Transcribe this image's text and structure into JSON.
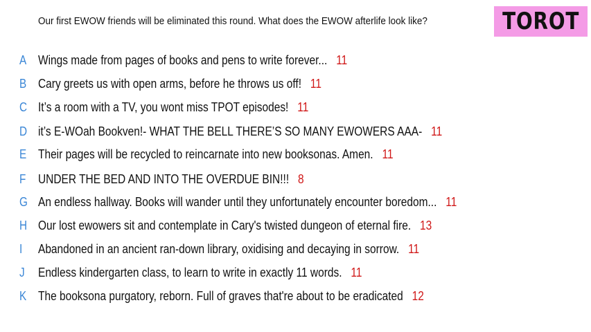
{
  "prompt": "Our first EWOW friends will be eliminated this round. What does the EWOW afterlife look like?",
  "logo": "TOROT",
  "colors": {
    "letter": "#3a86d6",
    "count": "#d01818",
    "logo_bg": "#f49be6"
  },
  "responses": [
    {
      "letter": "A",
      "text": "Wings made from pages of books and pens to write forever...",
      "count": "11"
    },
    {
      "letter": "B",
      "text": "Cary greets us with open arms, before he throws us off!",
      "count": "11"
    },
    {
      "letter": "C",
      "text": "It’s a room with a TV, you wont miss TPOT episodes!",
      "count": "11"
    },
    {
      "letter": "D",
      "text": "it’s E-WOah Bookven!- WHAT THE BELL THERE’S SO MANY EWOWERS AAA-",
      "count": "11"
    },
    {
      "letter": "E",
      "text": "Their pages will be recycled to reincarnate into new booksonas. Amen.",
      "count": "11"
    },
    {
      "letter": "F",
      "text": "UNDER THE BED AND INTO THE OVERDUE BIN!!!",
      "count": "8"
    },
    {
      "letter": "G",
      "text": "An endless hallway. Books will wander until they unfortunately encounter boredom...",
      "count": "11"
    },
    {
      "letter": "H",
      "text": "Our lost ewowers sit and contemplate in Cary's twisted dungeon of eternal fire.",
      "count": "13"
    },
    {
      "letter": "I",
      "text": "Abandoned in an ancient ran-down library, oxidising and decaying in sorrow.",
      "count": "11"
    },
    {
      "letter": "J",
      "text": "Endless kindergarten class, to learn to write in exactly 11 words.",
      "count": "11"
    },
    {
      "letter": "K",
      "text": "The booksona purgatory, reborn. Full of graves that're about to be eradicated",
      "count": "12"
    }
  ]
}
